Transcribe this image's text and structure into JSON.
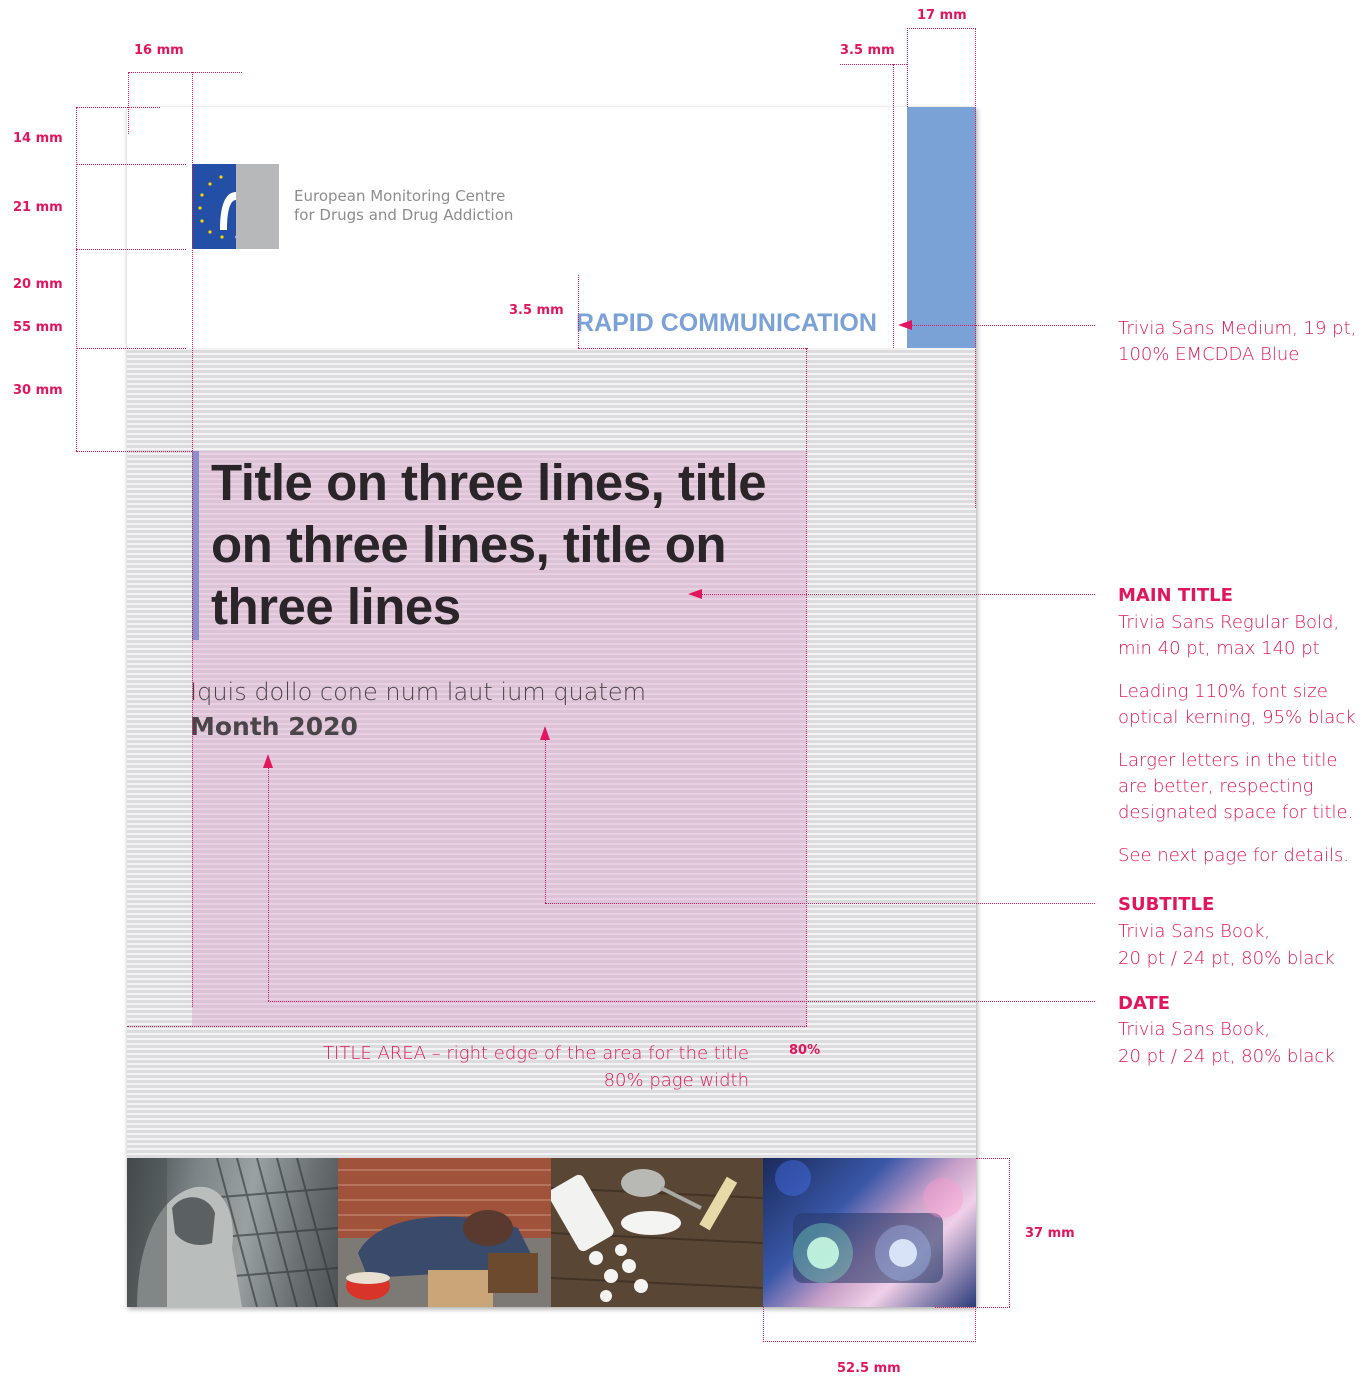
{
  "dimensions": {
    "top_margin": "16 mm",
    "strip_width": "17 mm",
    "strip_gap_top": "3.5 mm",
    "header_top": "14 mm",
    "logo_height": "21 mm",
    "gap_below_logo": "20 mm",
    "header_total": "55 mm",
    "title_offset": "30 mm",
    "rapid_gap": "3.5 mm",
    "title_area_width": "80%",
    "photo_height": "37 mm",
    "photo_width": "52.5 mm"
  },
  "header": {
    "org_line1": "European Monitoring Centre",
    "org_line2": "for Drugs and Drug Addiction",
    "series_label": "RAPID COMMUNICATION"
  },
  "cover": {
    "main_title": "Title on three lines, title on three lines, title on three lines",
    "subtitle": "Iquis dollo cone num laut ium quatem",
    "date": "Month 2020",
    "title_area_note_line1": "TITLE AREA – right edge of the area for the title",
    "title_area_note_line2": "80% page width"
  },
  "annotations": {
    "series_label_spec_line1": "Trivia Sans Medium, 19 pt,",
    "series_label_spec_line2": "100% EMCDDA Blue",
    "main_title_heading": "MAIN TITLE",
    "main_title_spec_1": "Trivia Sans Regular Bold,",
    "main_title_spec_2": "min 40 pt, max 140 pt",
    "main_title_spec_3": "Leading 110% font size",
    "main_title_spec_4": "optical kerning, 95% black",
    "main_title_spec_5": "Larger letters in the title",
    "main_title_spec_6": "are better, respecting",
    "main_title_spec_7": "designated space for title.",
    "main_title_spec_8": "See next page for details.",
    "subtitle_heading": "SUBTITLE",
    "subtitle_spec_1": "Trivia Sans Book,",
    "subtitle_spec_2": "20 pt / 24 pt, 80% black",
    "date_heading": "DATE",
    "date_spec_1": "Trivia Sans Book,",
    "date_spec_2": "20 pt / 24 pt, 80% black"
  },
  "photos": [
    "hooded-person-at-fence",
    "person-sleeping-on-street",
    "drugs-pills-syringe",
    "police-car-lights"
  ],
  "colors": {
    "accent": "#e2165e",
    "emcdda_blue": "#7ba2d6",
    "logo_blue": "#2350a6",
    "title_area": "#e7c4da"
  }
}
